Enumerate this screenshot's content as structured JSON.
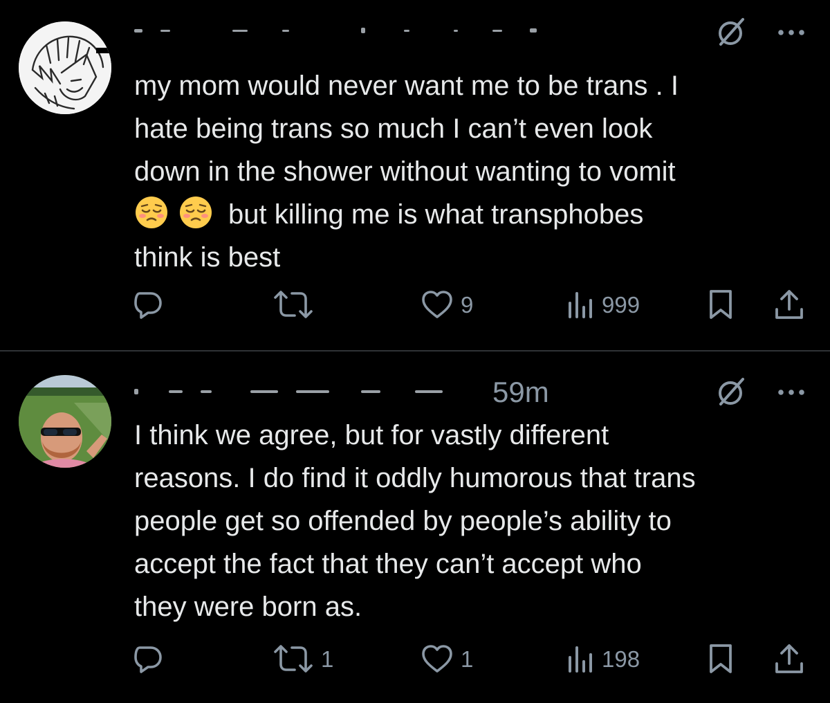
{
  "tweets": [
    {
      "timestamp": "",
      "text_line_1": "my mom would never want me to be trans . I\nhate being trans so much I can’t even look\ndown in the shower without wanting to vomit\n",
      "emojis": [
        "pensive-face-emoji",
        "pensive-face-emoji"
      ],
      "text_line_2": "but killing me is what transphobes\nthink is best",
      "replies": "",
      "retweets": "",
      "likes": "9",
      "views": "999"
    },
    {
      "timestamp": "59m",
      "text": "I think we agree, but for vastly different\nreasons. I do find it oddly humorous that trans\npeople get so offended by people’s ability to\naccept the fact that they can’t accept who\nthey were born as.",
      "replies": "",
      "retweets": "1",
      "likes": "1",
      "views": "198"
    }
  ],
  "icons": {
    "reply": "reply-icon",
    "retweet": "retweet-icon",
    "like": "heart-icon",
    "views": "views-icon",
    "bookmark": "bookmark-icon",
    "share": "share-icon",
    "grok": "grok-icon",
    "more": "more-icon"
  },
  "colors": {
    "background": "#000000",
    "text": "#e7e9ea",
    "secondary": "#8b98a5",
    "divider": "#2f3336"
  }
}
